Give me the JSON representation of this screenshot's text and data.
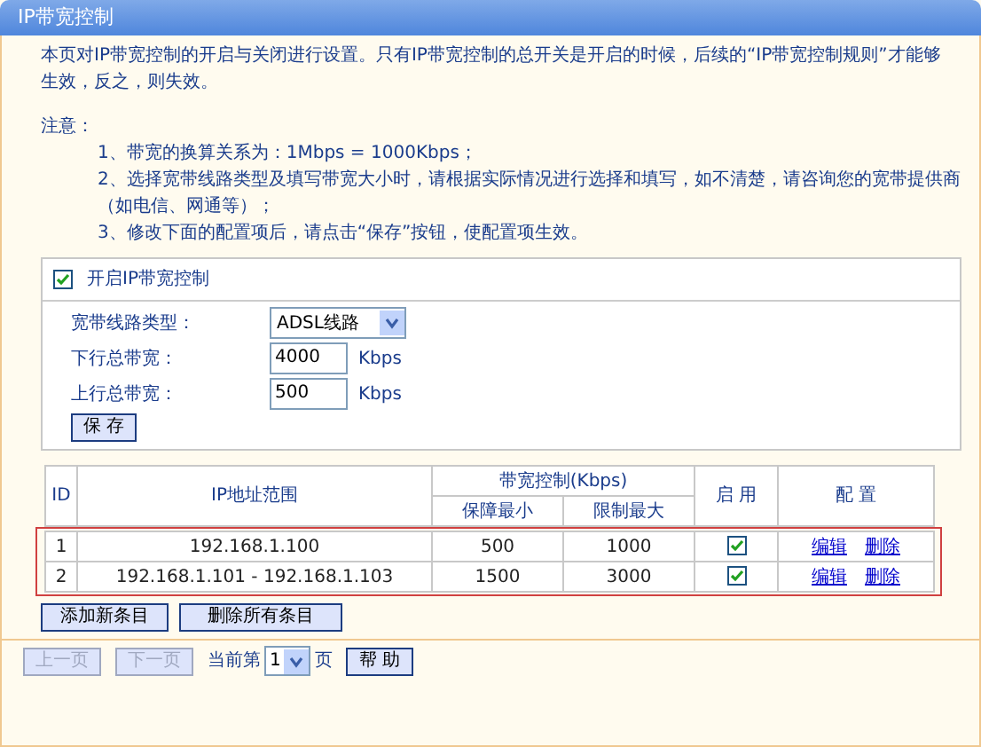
{
  "window": {
    "title": "IP带宽控制"
  },
  "intro": "本页对IP带宽控制的开启与关闭进行设置。只有IP带宽控制的总开关是开启的时候，后续的“IP带宽控制规则”才能够生效，反之，则失效。",
  "notice": {
    "heading": "注意：",
    "items": [
      "1、带宽的换算关系为：1Mbps = 1000Kbps；",
      "2、选择宽带线路类型及填写带宽大小时，请根据实际情况进行选择和填写，如不清楚，请咨询您的宽带提供商（如电信、网通等）；",
      "3、修改下面的配置项后，请点击“保存”按钮，使配置项生效。"
    ]
  },
  "settings": {
    "enable": {
      "label": "开启IP带宽控制",
      "checked": true
    },
    "fields": [
      {
        "kind": "select",
        "label": "宽带线路类型：",
        "value": "ADSL线路"
      },
      {
        "kind": "input",
        "label": "下行总带宽：",
        "value": "4000",
        "unit": "Kbps"
      },
      {
        "kind": "input",
        "label": "上行总带宽：",
        "value": "500",
        "unit": "Kbps"
      }
    ],
    "save_button": "保 存"
  },
  "table": {
    "columns": {
      "id": "ID",
      "ip": "IP地址范围",
      "bandwidth": "带宽控制(Kbps)",
      "min": "保障最小",
      "max": "限制最大",
      "enabled": "启 用",
      "config": "配 置"
    },
    "rows": [
      {
        "id": "1",
        "ip": "192.168.1.100",
        "min": "500",
        "max": "1000",
        "enabled": true,
        "edit": "编辑",
        "delete": "删除"
      },
      {
        "id": "2",
        "ip": "192.168.1.101 - 192.168.1.103",
        "min": "1500",
        "max": "3000",
        "enabled": true,
        "edit": "编辑",
        "delete": "删除"
      }
    ]
  },
  "actions": [
    "添加新条目",
    "删除所有条目"
  ],
  "pager": {
    "prev": {
      "label": "上一页",
      "disabled": true
    },
    "next": {
      "label": "下一页",
      "disabled": true
    },
    "prefix": "当前第",
    "page": "1",
    "suffix": "页",
    "help": "帮 助"
  }
}
